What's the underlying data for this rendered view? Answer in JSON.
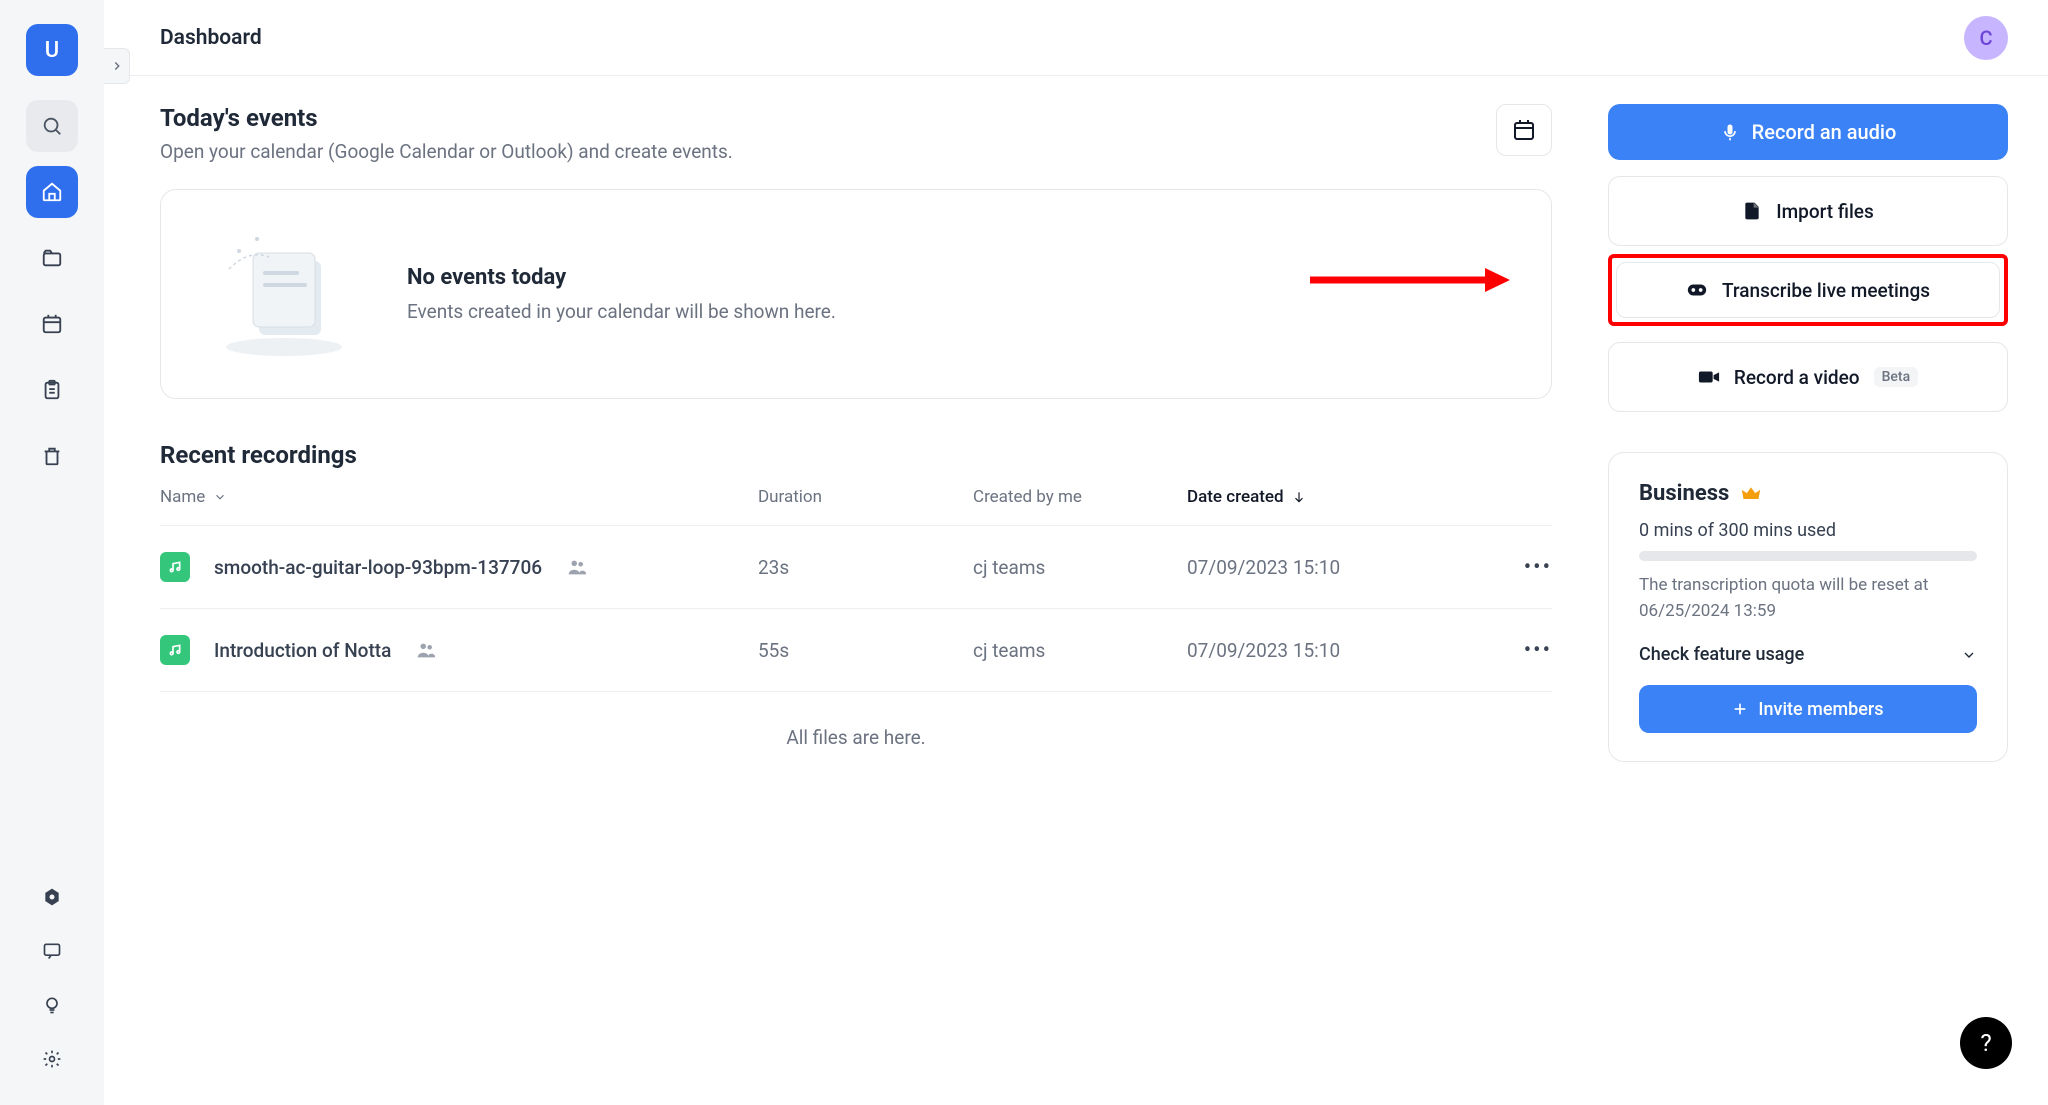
{
  "logo_letter": "U",
  "header": {
    "title": "Dashboard",
    "avatar_letter": "C"
  },
  "events": {
    "title": "Today's events",
    "subtitle": "Open your calendar (Google Calendar or Outlook) and create events.",
    "empty_title": "No events today",
    "empty_sub": "Events created in your calendar will be shown here."
  },
  "recent": {
    "title": "Recent recordings",
    "columns": {
      "name": "Name",
      "duration": "Duration",
      "created_by": "Created by me",
      "date_created": "Date created"
    },
    "rows": [
      {
        "name": "smooth-ac-guitar-loop-93bpm-137706",
        "duration": "23s",
        "created_by": "cj teams",
        "date": "07/09/2023 15:10"
      },
      {
        "name": "Introduction of Notta",
        "duration": "55s",
        "created_by": "cj teams",
        "date": "07/09/2023 15:10"
      }
    ],
    "footer": "All files are here."
  },
  "actions": {
    "record_audio": "Record an audio",
    "import_files": "Import files",
    "transcribe": "Transcribe live meetings",
    "record_video": "Record a video",
    "beta_badge": "Beta"
  },
  "business": {
    "title": "Business",
    "usage": "0 mins of 300 mins used",
    "reset_note": "The transcription quota will be reset at 06/25/2024 13:59",
    "feature_link": "Check feature usage",
    "invite": "Invite members"
  },
  "help": "?"
}
